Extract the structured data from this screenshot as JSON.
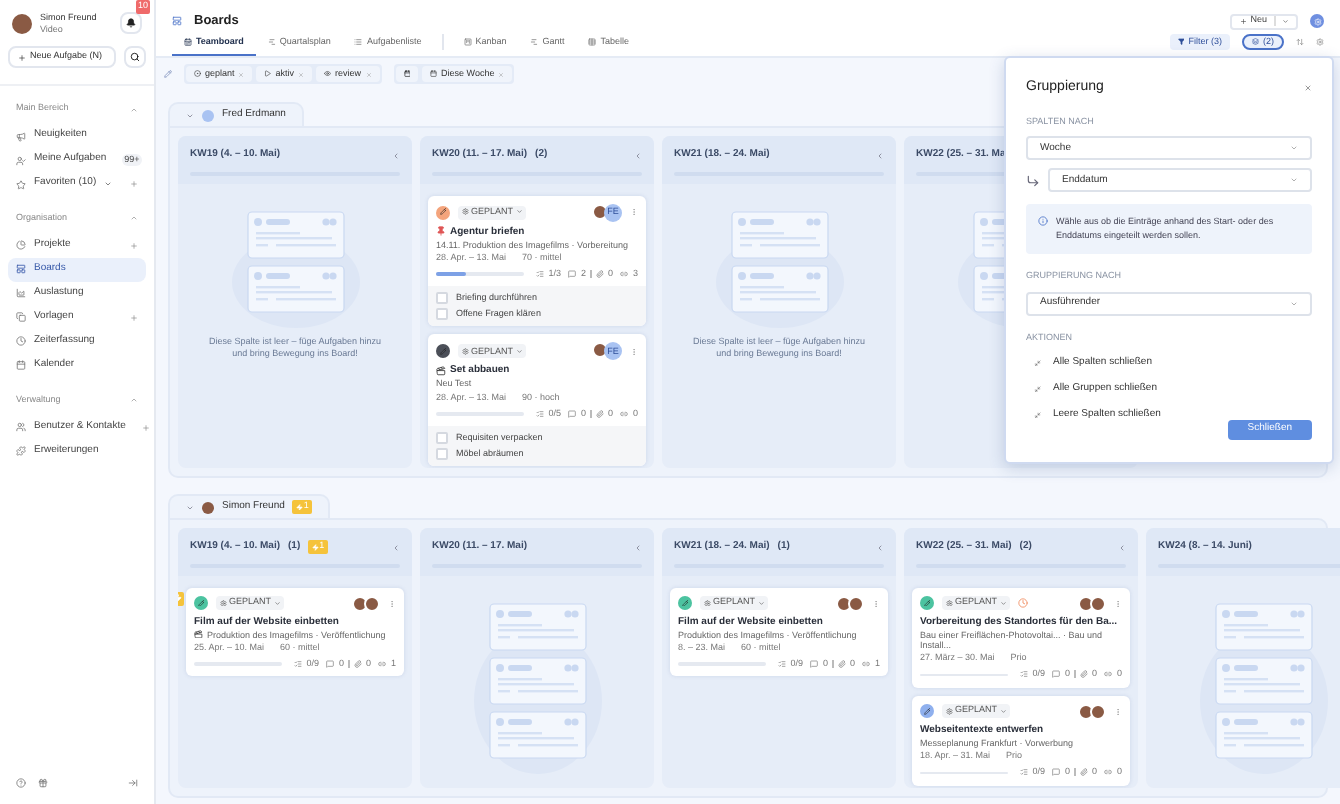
{
  "sidebar": {
    "user": {
      "name": "Simon Freund",
      "role": "Video"
    },
    "notification_badge": "10",
    "new_task_button": "Neue Aufgabe (N)",
    "sections": [
      {
        "title": "Main Bereich",
        "expanded": true,
        "items": [
          {
            "label": "Neuigkeiten",
            "selected": false
          },
          {
            "label": "Meine Aufgaben",
            "selected": false,
            "badge": "99+"
          },
          {
            "label": "Favoriten (10)",
            "selected": false,
            "expandable": true,
            "addable": true
          }
        ]
      },
      {
        "title": "Organisation",
        "expanded": true,
        "items": [
          {
            "label": "Projekte",
            "selected": false,
            "addable": true
          },
          {
            "label": "Boards",
            "selected": true
          },
          {
            "label": "Auslastung",
            "selected": false
          },
          {
            "label": "Vorlagen",
            "selected": false,
            "addable": true
          },
          {
            "label": "Zeiterfassung",
            "selected": false
          },
          {
            "label": "Kalender",
            "selected": false
          }
        ]
      },
      {
        "title": "Verwaltung",
        "expanded": true,
        "items": [
          {
            "label": "Benutzer & Kontakte",
            "selected": false,
            "addable": true
          },
          {
            "label": "Erweiterungen",
            "selected": false
          }
        ]
      }
    ]
  },
  "header": {
    "title": "Boards",
    "new_button": "Neu",
    "filter_button": "Filter (3)",
    "grouping_button": "(2)"
  },
  "tabs": [
    {
      "label": "Teamboard",
      "selected": true
    },
    {
      "label": "Quartalsplan",
      "selected": false
    },
    {
      "label": "Aufgabenliste",
      "selected": false
    },
    {
      "label": "Kanban",
      "selected": false
    },
    {
      "label": "Gantt",
      "selected": false
    },
    {
      "label": "Tabelle",
      "selected": false
    }
  ],
  "status_filters": [
    "geplant",
    "aktiv",
    "review"
  ],
  "date_filter": "Diese Woche",
  "groups": [
    {
      "name": "Fred Erdmann",
      "avatar": {
        "kind": "initials"
      },
      "expanded": true,
      "columns": [
        {
          "title": "KW19 (4. – 10. Mai)",
          "level": 0,
          "empty_message": "Diese Spalte ist leer – füge Aufgaben hinzu und bring Bewegung ins Board!"
        },
        {
          "title": "KW20 (11. – 17. Mai)",
          "count": "(2)",
          "level": 0,
          "cards": [
            {
              "color": "#f4a47c",
              "status": "GEPLANT",
              "title_icon": {
                "kind": "pin"
              },
              "title": "Agentur briefen",
              "subtitle": "14.11. Produktion des Imagefilms · Vorbereitung",
              "dates": "28. Apr. – 13. Mai",
              "priority": "70 · mittel",
              "level": 0.35,
              "subtasks": "1/3",
              "comments": "2",
              "attachments": "0",
              "links": "3",
              "overdue": false,
              "flagged": false,
              "avatars": [
                {
                  "kind": "photo"
                },
                {
                  "kind": "initials",
                  "text": "FE"
                }
              ],
              "checklist": [
                {
                  "label": "Briefing durchführen",
                  "checked": false
                },
                {
                  "label": "Offene Fragen klären",
                  "checked": false
                }
              ]
            },
            {
              "color": "#4b4f58",
              "status": "GEPLANT",
              "title_icon": {
                "kind": "clapper"
              },
              "title": "Set abbauen",
              "subtitle": "Neu Test",
              "dates": "28. Apr. – 13. Mai",
              "priority": "90 · hoch",
              "level": 0,
              "subtasks": "0/5",
              "comments": "0",
              "attachments": "0",
              "links": "0",
              "overdue": false,
              "flagged": false,
              "avatars": [
                {
                  "kind": "photo"
                },
                {
                  "kind": "initials",
                  "text": "FE"
                }
              ],
              "checklist": [
                {
                  "label": "Requisiten verpacken",
                  "checked": false
                },
                {
                  "label": "Möbel abräumen",
                  "checked": false
                }
              ]
            }
          ]
        },
        {
          "title": "KW21 (18. – 24. Mai)",
          "level": 0,
          "empty_message": "Diese Spalte ist leer – füge Aufgaben hinzu und bring Bewegung ins Board!"
        },
        {
          "title": "KW22 (25. – 31. Ma",
          "level": 0
        }
      ]
    },
    {
      "name": "Simon Freund",
      "avatar": {
        "kind": "photo"
      },
      "expanded": true,
      "warning_count": "1",
      "columns": [
        {
          "title": "KW19 (4. – 10. Mai)",
          "count": "(1)",
          "warning_count": "1",
          "level": 0,
          "cards": [
            {
              "color": "#4cc3a0",
              "status": "GEPLANT",
              "title": "Film auf der Website einbetten",
              "subtitle_icon": {
                "kind": "clapper"
              },
              "subtitle": "Produktion des Imagefilms · Veröffentlichung",
              "dates": "25. Apr. – 10. Mai",
              "priority": "60 · mittel",
              "level": 0,
              "subtasks": "0/9",
              "comments": "0",
              "attachments": "0",
              "links": "1",
              "overdue": false,
              "flagged": true,
              "avatars": [
                {
                  "kind": "photo"
                },
                {
                  "kind": "photo"
                }
              ]
            }
          ]
        },
        {
          "title": "KW20 (11. – 17. Mai)",
          "level": 0
        },
        {
          "title": "KW21 (18. – 24. Mai)",
          "count": "(1)",
          "level": 0,
          "cards": [
            {
              "color": "#4cc3a0",
              "status": "GEPLANT",
              "title": "Film auf der Website einbetten",
              "subtitle": "Produktion des Imagefilms · Veröffentlichung",
              "dates": "8. – 23. Mai",
              "priority": "60 · mittel",
              "level": 0,
              "subtasks": "0/9",
              "comments": "0",
              "attachments": "0",
              "links": "1",
              "overdue": false,
              "flagged": false,
              "avatars": [
                {
                  "kind": "photo"
                },
                {
                  "kind": "photo"
                }
              ]
            }
          ]
        },
        {
          "title": "KW22 (25. – 31. Mai)",
          "count": "(2)",
          "level": 0,
          "cards": [
            {
              "color": "#4cc3a0",
              "status": "GEPLANT",
              "title": "Vorbereitung des Standortes für den Ba...",
              "subtitle": "Bau einer Freiflächen-Photovoltai... · Bau und Install...",
              "dates": "27. März – 30. Mai",
              "priority": "Prio",
              "level": 0,
              "subtasks": "0/9",
              "comments": "0",
              "attachments": "0",
              "links": "0",
              "overdue": true,
              "flagged": false,
              "avatars": [
                {
                  "kind": "photo"
                },
                {
                  "kind": "photo"
                }
              ]
            },
            {
              "color": "#8fb0ee",
              "status": "GEPLANT",
              "title": "Webseitentexte entwerfen",
              "subtitle": "Messeplanung Frankfurt · Vorwerbung",
              "dates": "18. Apr. – 31. Mai",
              "priority": "Prio",
              "level": 0,
              "subtasks": "0/9",
              "comments": "0",
              "attachments": "0",
              "links": "0",
              "overdue": false,
              "flagged": false,
              "avatars": [
                {
                  "kind": "photo"
                },
                {
                  "kind": "photo"
                }
              ]
            }
          ]
        },
        {
          "title": "KW24 (8. – 14. Juni)",
          "level": 0
        }
      ]
    }
  ],
  "dialog": {
    "title": "Gruppierung",
    "columns_label": "SPALTEN NACH",
    "columns_value": "Woche",
    "date_value": "Enddatum",
    "info": "Wähle aus ob die Einträge anhand des Start- oder des Enddatums eingeteilt werden sollen.",
    "grouping_label": "GRUPPIERUNG NACH",
    "grouping_value": "Ausführender",
    "actions_label": "AKTIONEN",
    "actions": [
      "Alle Spalten schließen",
      "Alle Gruppen schließen",
      "Leere Spalten schließen"
    ],
    "close_button": "Schließen"
  }
}
